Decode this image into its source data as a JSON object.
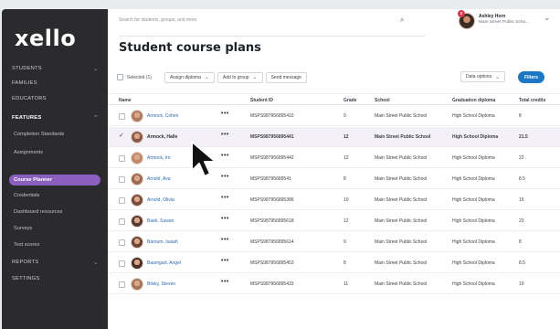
{
  "app": {
    "logo": "xello"
  },
  "sidebar": {
    "items": [
      {
        "label": "STUDENTS",
        "chevron": "⌄"
      },
      {
        "label": "FAMILIES"
      },
      {
        "label": "EDUCATORS"
      },
      {
        "label": "FEATURES",
        "chevron": "⌃"
      },
      {
        "label": "REPORTS",
        "chevron": "⌄"
      },
      {
        "label": "SETTINGS"
      }
    ],
    "features": [
      "Completion Standards",
      "Assignments",
      "Course Planner",
      "Credentials",
      "Dashboard resources",
      "Surveys",
      "Test scores"
    ]
  },
  "header": {
    "search_placeholder": "Search for students, groups, and more",
    "user": {
      "name": "Ashley Horn",
      "school": "Main Street Public Scho...",
      "badge": "2"
    }
  },
  "page": {
    "title": "Student course plans"
  },
  "toolbar": {
    "selected_label": "Selected (1)",
    "assign_diploma": "Assign diploma",
    "add_to_group": "Add to group",
    "send_message": "Send message",
    "data_options": "Data options",
    "filters": "Filters"
  },
  "table": {
    "columns": [
      "Name",
      "Student ID",
      "Grade",
      "School",
      "Graduation diploma",
      "Total credits"
    ],
    "rows": [
      {
        "name": "Armock, Cohen",
        "id": "MSPS987956895410",
        "grade": "9",
        "school": "Main Street Public School",
        "diploma": "High School Diploma",
        "credits": "8",
        "selected": false,
        "avatar": "#b07a5e"
      },
      {
        "name": "Armock, Halle",
        "id": "MSPS987956895441",
        "grade": "12",
        "school": "Main Street Public School",
        "diploma": "High School Diploma",
        "credits": "21.5",
        "selected": true,
        "avatar": "#8c5a4a"
      },
      {
        "name": "Armock, Iro",
        "id": "MSPS987956895442",
        "grade": "12",
        "school": "Main Street Public School",
        "diploma": "High School Diploma",
        "credits": "22",
        "selected": false,
        "avatar": "#c08a6a"
      },
      {
        "name": "Arnold, Ava",
        "id": "MSPS98795689541",
        "grade": "8",
        "school": "Main Street Public School",
        "diploma": "High School Diploma",
        "credits": "8.5",
        "selected": false,
        "avatar": "#9a6b52"
      },
      {
        "name": "Arnold, Olivia",
        "id": "MSPS987956895386",
        "grade": "10",
        "school": "Main Street Public School",
        "diploma": "High School Diploma",
        "credits": "16",
        "selected": false,
        "avatar": "#7a4a3c"
      },
      {
        "name": "Baek, Suwan",
        "id": "MSPS987956895618",
        "grade": "12",
        "school": "Main Street Public School",
        "diploma": "High School Diploma",
        "credits": "23",
        "selected": false,
        "avatar": "#5a3a30"
      },
      {
        "name": "Barnum, Isaiah",
        "id": "MSPS987956895614",
        "grade": "9",
        "school": "Main Street Public School",
        "diploma": "High School Diploma",
        "credits": "8",
        "selected": false,
        "avatar": "#6e4434"
      },
      {
        "name": "Baumgart, Angel",
        "id": "MSPS987956895453",
        "grade": "8",
        "school": "Main Street Public School",
        "diploma": "High School Diploma",
        "credits": "8.5",
        "selected": false,
        "avatar": "#4a3028"
      },
      {
        "name": "Bilsky, Steven",
        "id": "MSPS987956895433",
        "grade": "11",
        "school": "Main Street Public School",
        "diploma": "High School Diploma",
        "credits": "19",
        "selected": false,
        "avatar": "#a87458"
      }
    ]
  }
}
